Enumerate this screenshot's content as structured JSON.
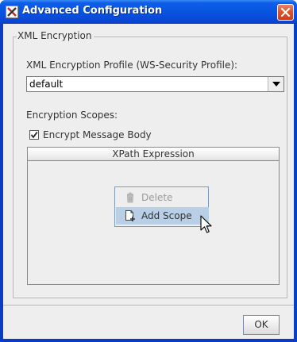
{
  "window": {
    "title": "Advanced Configuration"
  },
  "xml_encryption": {
    "group_title": "XML Encryption",
    "profile_label": "XML Encryption Profile (WS-Security Profile):",
    "profile_value": "default",
    "scopes_label": "Encryption Scopes:",
    "encrypt_body_label": "Encrypt Message Body",
    "encrypt_body_checked": true,
    "table": {
      "columns": [
        "XPath Expression"
      ],
      "rows": []
    }
  },
  "context_menu": {
    "items": [
      {
        "label": "Delete",
        "icon": "trash-icon",
        "enabled": false
      },
      {
        "label": "Add Scope",
        "icon": "add-document-icon",
        "enabled": true,
        "highlighted": true
      }
    ]
  },
  "footer": {
    "ok_label": "OK"
  },
  "colors": {
    "titlebar": "#0755e2",
    "close_button": "#d9532d",
    "menu_highlight": "#b8cfe5",
    "client_background": "#eeeeee"
  }
}
